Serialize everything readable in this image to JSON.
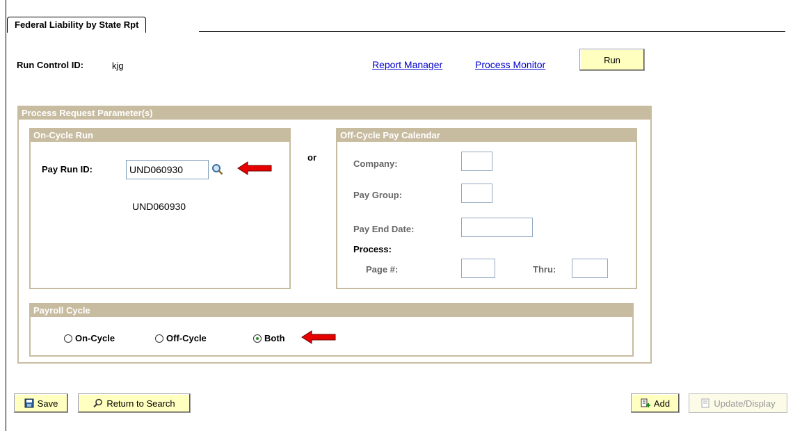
{
  "page": {
    "tab_title": "Federal Liability by State Rpt",
    "run_control_label": "Run Control ID:",
    "run_control_value": "kjg",
    "links": {
      "report_manager": "Report Manager",
      "process_monitor": "Process Monitor"
    },
    "run_button": "Run"
  },
  "params": {
    "title": "Process Request Parameter(s)",
    "or_label": "or",
    "on_cycle": {
      "title": "On-Cycle Run",
      "pay_run_label": "Pay Run ID:",
      "pay_run_value": "UND060930",
      "pay_run_desc": "UND060930"
    },
    "off_cycle": {
      "title": "Off-Cycle Pay Calendar",
      "company_label": "Company:",
      "pay_group_label": "Pay Group:",
      "pay_end_date_label": "Pay End Date:",
      "process_label": "Process:",
      "page_label": "Page #:",
      "thru_label": "Thru:",
      "company_value": "",
      "pay_group_value": "",
      "pay_end_date_value": "",
      "page_value": "",
      "thru_value": ""
    },
    "payroll_cycle": {
      "title": "Payroll Cycle",
      "options": [
        "On-Cycle",
        "Off-Cycle",
        "Both"
      ],
      "selected": "Both"
    }
  },
  "toolbar": {
    "save": "Save",
    "return_to_search": "Return to Search",
    "add": "Add",
    "update_display": "Update/Display"
  },
  "colors": {
    "panel_header": "#c8bca0",
    "button_bg": "#ffffc0",
    "link": "#0000cc",
    "arrow": "#e60000"
  }
}
